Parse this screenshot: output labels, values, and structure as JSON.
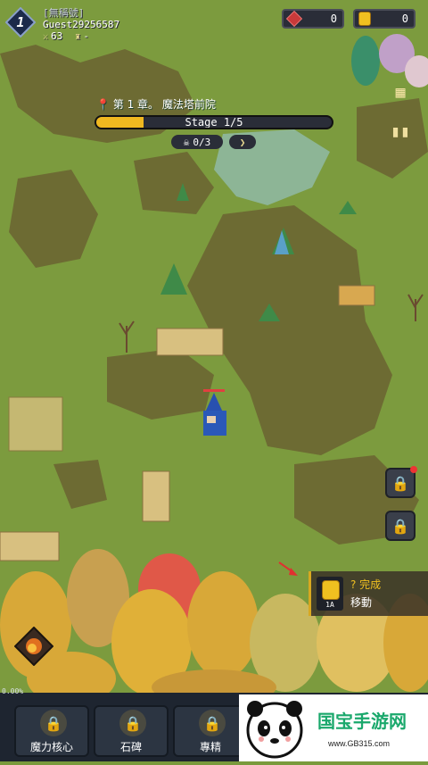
{
  "player": {
    "level": "1",
    "title": "[無稱號]",
    "name": "Guest29256587",
    "power": "63",
    "rank": "-"
  },
  "currency": {
    "gems": "0",
    "coins": "0"
  },
  "stage": {
    "chapter": "第 1 章。 魔法塔前院",
    "label": "Stage 1/5",
    "progress": 0.2,
    "kills": "0/3",
    "next_icon": "chevron-right-icon"
  },
  "quest": {
    "status": "? 完成",
    "text": "移動",
    "icon_level": "1A"
  },
  "bottom_menu": {
    "progress": "0.00%",
    "items": [
      {
        "label": "魔力核心",
        "icon": "lock-icon"
      },
      {
        "label": "石碑",
        "icon": "lock-icon"
      },
      {
        "label": "專精",
        "icon": "lock-icon"
      }
    ]
  },
  "watermark": {
    "text": "国宝手游网",
    "url": "www.GB315.com"
  },
  "colors": {
    "grass": "#7a9a3c",
    "dirt": "#6b6a32",
    "accent": "#f0b820",
    "panel": "#2a2d38"
  }
}
